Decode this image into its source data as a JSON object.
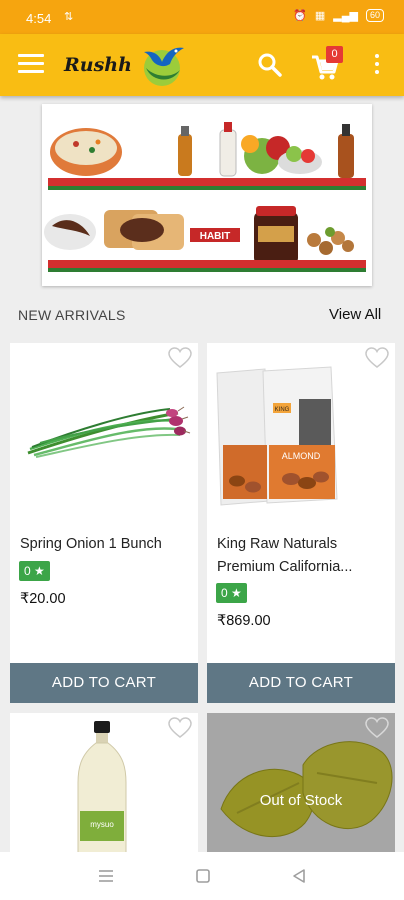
{
  "status_bar": {
    "time": "4:54",
    "battery": "60"
  },
  "app_bar": {
    "brand": "Rushh",
    "cart_count": "0"
  },
  "section": {
    "title": "NEW ARRIVALS",
    "view_all": "View All"
  },
  "banner": {
    "brand_label": "HABIT"
  },
  "products": [
    {
      "name": "Spring Onion 1 Bunch",
      "rating": "0 ★",
      "price": "₹20.00",
      "cta": "ADD TO CART"
    },
    {
      "name": "King Raw Naturals Premium California...",
      "rating": "0 ★",
      "price": "₹869.00",
      "cta": "ADD TO CART",
      "package_brand": "KING",
      "package_label": "ALMOND"
    },
    {
      "name": "",
      "bottle_label": "mysuo"
    },
    {
      "name": "",
      "overlay": "Out of Stock"
    }
  ],
  "colors": {
    "status_bar": "#f6a50f",
    "app_bar": "#f9bd13",
    "add_to_cart": "#5f7785",
    "rating_badge": "#3ca548",
    "cart_badge": "#e53935"
  }
}
